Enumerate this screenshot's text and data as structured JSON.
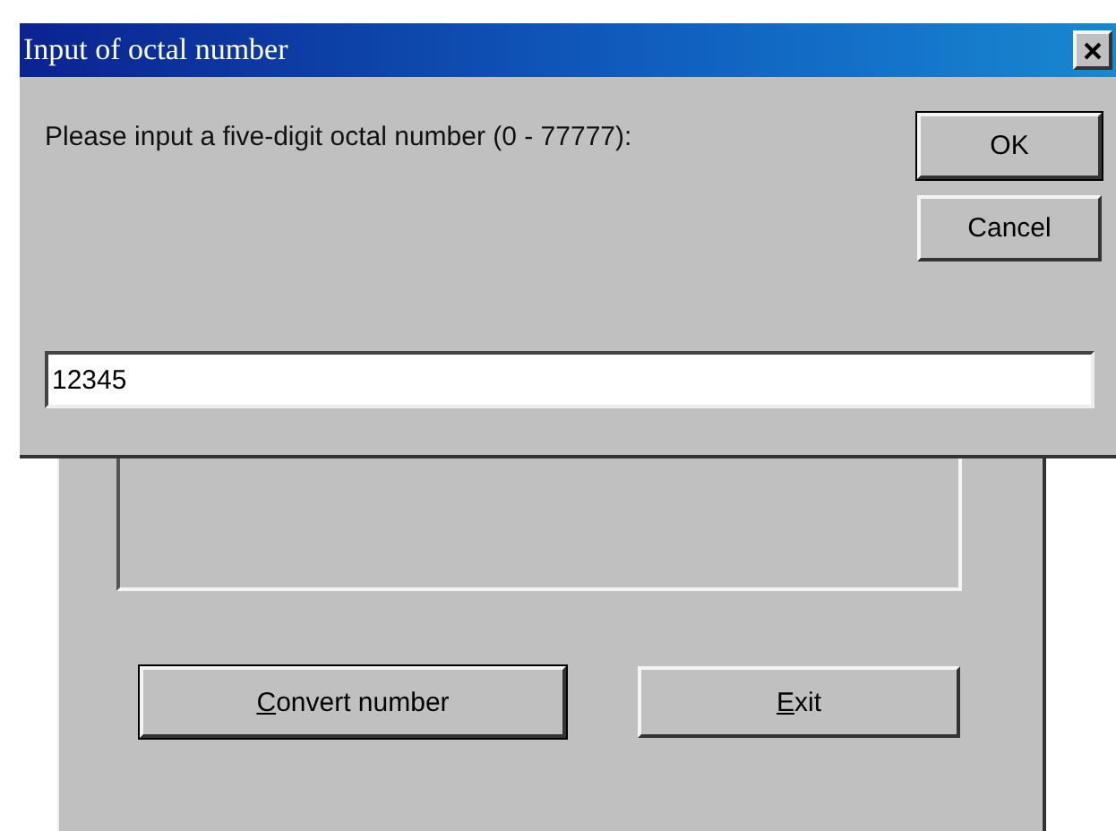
{
  "dialog": {
    "title": "Input of octal number",
    "prompt": "Please input a five-digit octal number (0 - 77777):",
    "buttons": [
      "OK",
      "Cancel"
    ],
    "value": "12345"
  },
  "form_behind": {
    "buttons": [
      "Convert number",
      "Exit"
    ]
  }
}
